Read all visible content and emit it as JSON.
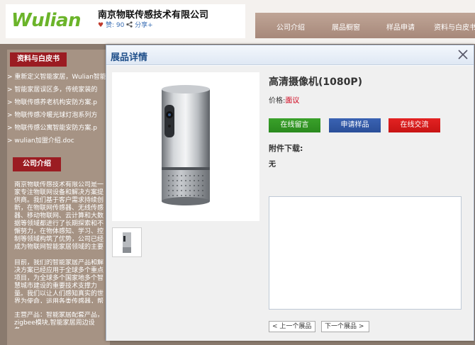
{
  "header": {
    "logo_text": "Wulian",
    "company_name": "南京物联传感技术有限公司",
    "likes_label": "赞: 90",
    "share_label": "分享+"
  },
  "nav": {
    "items": [
      "公司介绍",
      "展品橱窗",
      "样品申请",
      "资料与白皮书"
    ]
  },
  "sidebar": {
    "docs_tab": "资料与白皮书",
    "docs": [
      "重新定义智能家居，Wulian智能",
      "智能家居误区多，传统家装的",
      "物联传感养老机构安防方案.p",
      "物联传感冷暖光球灯泡系列方",
      "物联传感公寓智能安防方案.p",
      "wulian加盟介绍.doc"
    ],
    "company_tab": "公司介绍",
    "intro_p1": "南京物联传感技术有限公司是一家专注物联网设备和解决方案提供商。我们基于客户需求持续创新，在物联网传感器、无线传感器、移动物联网、云计算和大数据等领域都进行了长期探索和不懈努力，在物体感知、学习、控制等领域构筑了优势，公司已经成为物联网智能家居领域的主要推动者之一。",
    "intro_p2": "目前，我们的智能家居产品和解决方案已经应用于全球多个重点项目，为全球多个国家地多个智慧城市建设的重要技术支撑力量。我们以让人们感知真实的世界为使命，运用各类传感器，帮助不同行业。",
    "intro_p3": "主营产品：智能家居配套产品，zigbee模块,智能家居周边设备。"
  },
  "modal": {
    "title": "展品详情",
    "product_name": "高清摄像机(1080P)",
    "price_label": "价格:",
    "price_value": "面议",
    "buttons": {
      "message": "在线留言",
      "sample": "申请样品",
      "chat": "在线交流"
    },
    "attachments_title": "附件下载:",
    "attachments_none": "无",
    "prev_label": "< 上一个展品",
    "next_label": "下一个展品 >"
  },
  "colors": {
    "accent_green": "#2a8a1e",
    "accent_blue": "#2a4f99",
    "accent_red": "#c81414",
    "price_red": "#d0021b",
    "section_tab_red": "#9b1c22",
    "logo_green": "#6bb42a"
  }
}
